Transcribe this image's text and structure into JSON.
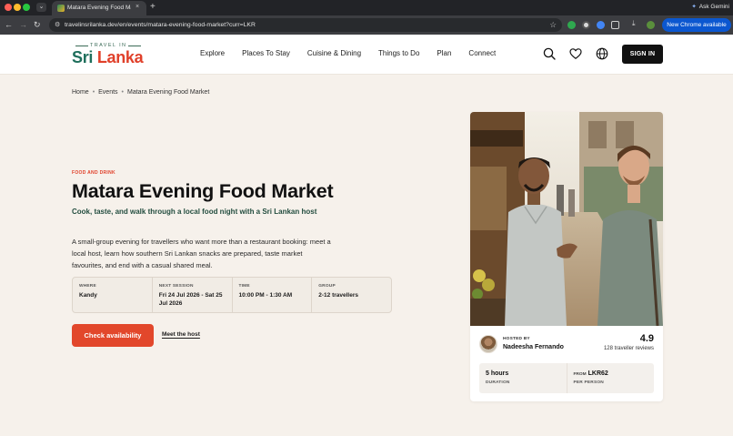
{
  "browser": {
    "tab_title": "Matara Evening Food Market",
    "tab_close": "×",
    "new_tab": "+",
    "url": "travelinsrilanka.dev/en/events/matara-evening-food-market?curr=LKR",
    "gemini_label": "Ask Gemini",
    "chrome_badge": "New Chrome available",
    "icons": [
      "back-arrow-icon",
      "forward-arrow-icon",
      "reload-icon",
      "site-info-icon",
      "bookmark-star-icon"
    ]
  },
  "site": {
    "logo_small": "TRAVEL IN",
    "logo_sri": "Sri",
    "logo_lanka": "Lanka",
    "nav": [
      "Explore",
      "Places To Stay",
      "Cuisine & Dining",
      "Things to Do",
      "Plan",
      "Connect"
    ],
    "sign_in": "SIGN IN",
    "header_icons": [
      "search-icon",
      "heart-icon",
      "globe-icon"
    ]
  },
  "breadcrumb": [
    "Home",
    "Events",
    "Matara Evening Food Market"
  ],
  "breadcrumb_separator": "•",
  "event": {
    "category": "FOOD AND DRINK",
    "title": "Matara Evening Food Market",
    "subtitle": "Cook, taste, and walk through a local food night with a Sri Lankan host",
    "description": "A small-group evening for travellers who want more than a restaurant booking: meet a local host, learn how southern Sri Lankan snacks are prepared, taste market favourites, and end with a casual shared meal.",
    "details": [
      {
        "label": "WHERE",
        "value": "Kandy"
      },
      {
        "label": "NEXT SESSION",
        "value": "Fri 24 Jul 2026 - Sat 25 Jul 2026"
      },
      {
        "label": "TIME",
        "value": "10:00 PM - 1:30 AM"
      },
      {
        "label": "GROUP",
        "value": "2-12 travellers"
      }
    ],
    "cta_primary": "Check availability",
    "cta_secondary": "Meet the host"
  },
  "host_card": {
    "hosted_label": "HOSTED BY",
    "host_name": "Nadeesha Fernando",
    "rating": "4.9",
    "reviews": "128 traveller reviews",
    "duration_value": "5 hours",
    "duration_label": "DURATION",
    "price_prefix": "FROM",
    "price_value": "LKR62",
    "price_label": "PER PERSON"
  },
  "colors": {
    "accent": "#e2472b",
    "brand_green": "#1f6f5c",
    "page_bg": "#f6f1eb",
    "chrome_blue": "#0b57d0"
  }
}
